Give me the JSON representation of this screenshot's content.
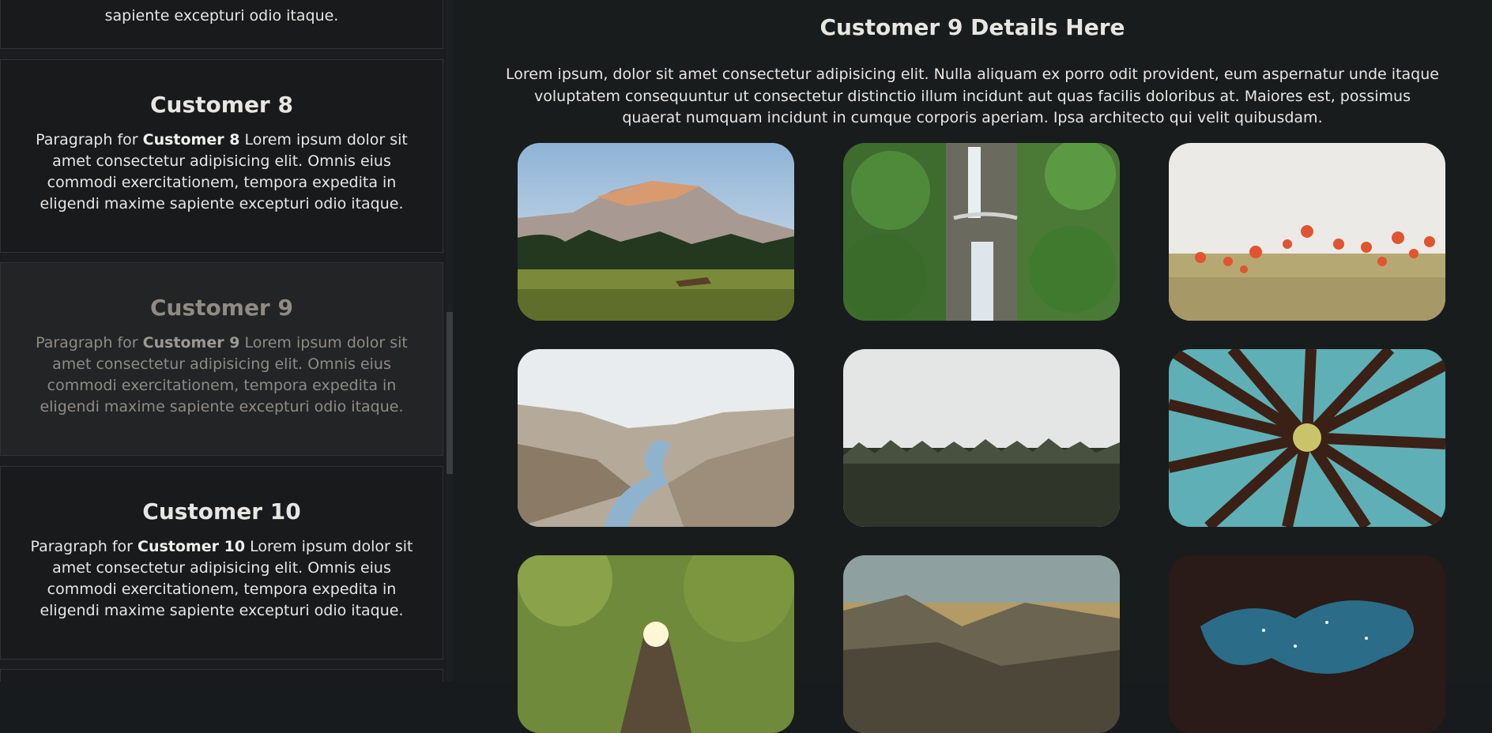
{
  "sidebar": {
    "cards": [
      {
        "title": "",
        "para_prefix": "",
        "para_bold": "",
        "para_rest": "sapiente excepturi odio itaque."
      },
      {
        "title": "Customer 8",
        "para_prefix": "Paragraph for ",
        "para_bold": "Customer 8",
        "para_rest": " Lorem ipsum dolor sit amet consectetur adipisicing elit. Omnis eius commodi exercitationem, tempora expedita in eligendi maxime sapiente excepturi odio itaque."
      },
      {
        "title": "Customer 9",
        "para_prefix": "Paragraph for ",
        "para_bold": "Customer 9",
        "para_rest": " Lorem ipsum dolor sit amet consectetur adipisicing elit. Omnis eius commodi exercitationem, tempora expedita in eligendi maxime sapiente excepturi odio itaque."
      },
      {
        "title": "Customer 10",
        "para_prefix": "Paragraph for ",
        "para_bold": "Customer 10",
        "para_rest": " Lorem ipsum dolor sit amet consectetur adipisicing elit. Omnis eius commodi exercitationem, tempora expedita in eligendi maxime sapiente excepturi odio itaque."
      }
    ]
  },
  "main": {
    "title": "Customer 9 Details Here",
    "paragraph": "Lorem ipsum, dolor sit amet consectetur adipisicing elit. Nulla aliquam ex porro odit provident, eum aspernatur unde itaque voluptatem consequuntur ut consectetur distinctio illum incidunt aut quas facilis doloribus at. Maiores est, possimus quaerat numquam incidunt in cumque corporis aperiam. Ipsa architecto qui velit quibusdam."
  },
  "colors": {
    "background": "#181b1d",
    "card_active": "#222426",
    "text": "#e8e6e3",
    "muted_text": "#8f8b84"
  }
}
